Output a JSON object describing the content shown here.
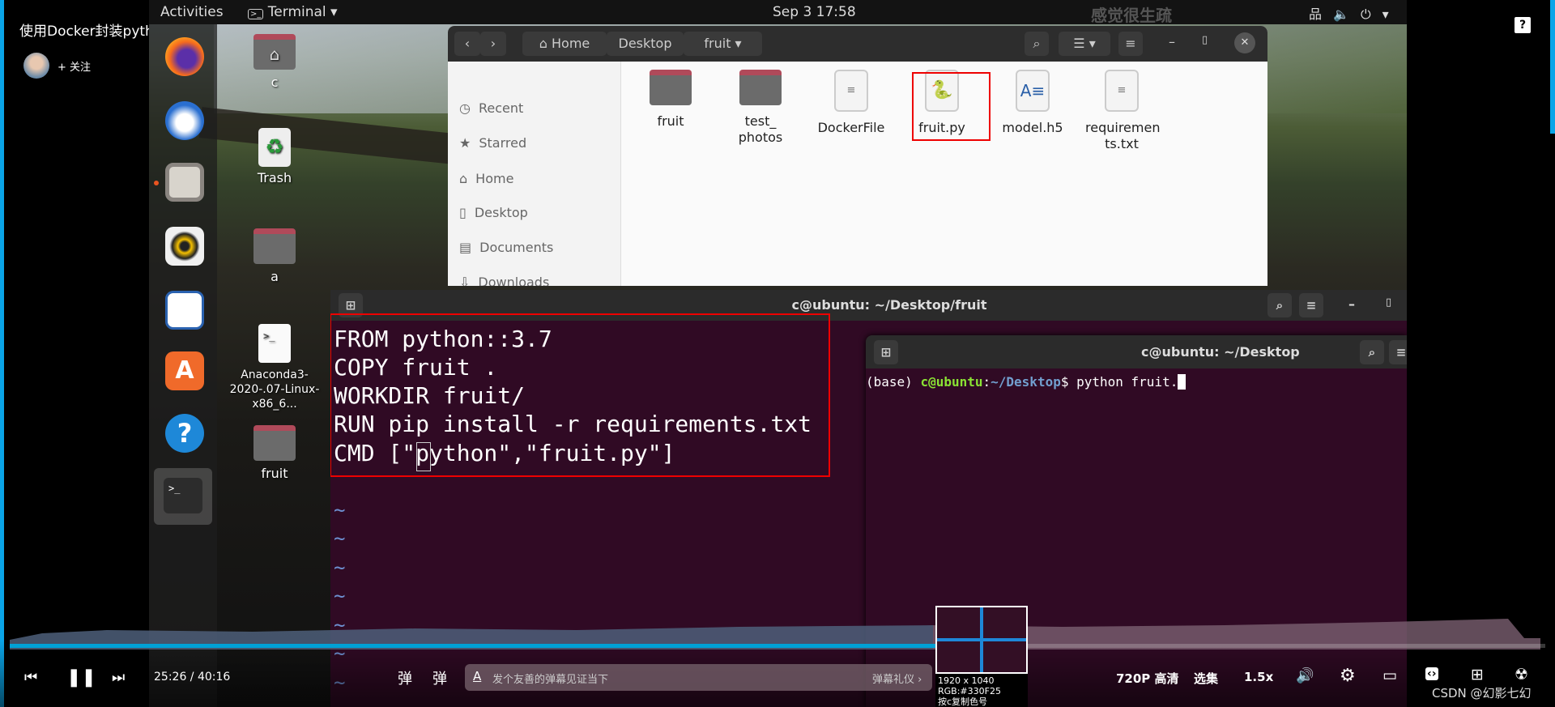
{
  "video": {
    "title": "使用Docker封装python应用",
    "follow": "+ 关注",
    "help_icon": "question-icon"
  },
  "topbar": {
    "activities": "Activities",
    "app": "Terminal ▾",
    "datetime": "Sep 3  17:58",
    "overlay_caption": "感觉很生疏"
  },
  "desktop": {
    "icons": [
      {
        "label": "c"
      },
      {
        "label": "Trash"
      },
      {
        "label": "a"
      },
      {
        "label": "Anaconda3-2020-.07-Linux-x86_6..."
      },
      {
        "label": "fruit"
      }
    ]
  },
  "dock": [
    "firefox-icon",
    "thunderbird-icon",
    "files-icon",
    "rhythmbox-icon",
    "writer-icon",
    "software-icon",
    "help-icon",
    "terminal-icon"
  ],
  "files": {
    "path": [
      "Home",
      "Desktop",
      "fruit"
    ],
    "sidebar": [
      "Recent",
      "Starred",
      "Home",
      "Desktop",
      "Documents",
      "Downloads"
    ],
    "items": [
      {
        "name": "fruit",
        "type": "folder"
      },
      {
        "name": "test_ photos",
        "type": "folder"
      },
      {
        "name": "DockerFile",
        "type": "text"
      },
      {
        "name": "fruit.py",
        "type": "python",
        "highlighted": true
      },
      {
        "name": "model.h5",
        "type": "document"
      },
      {
        "name": "requiremen ts.txt",
        "type": "text"
      }
    ]
  },
  "terminal_main": {
    "title": "c@ubuntu: ~/Desktop/fruit",
    "lines": [
      "FROM python::3.7",
      "COPY fruit .",
      "WORKDIR fruit/",
      "RUN pip install -r requirements.txt",
      "CMD [\"python\",\"fruit.py\"]"
    ],
    "tilde": "~"
  },
  "terminal_small": {
    "title": "c@ubuntu: ~/Desktop",
    "prompt_env": "(base) ",
    "prompt_user": "c@ubuntu",
    "prompt_sep": ":",
    "prompt_path": "~/Desktop",
    "prompt_end": "$ ",
    "command": "python fruit."
  },
  "player": {
    "progress": 0.635,
    "time": "25:26 / 40:16",
    "danmaku_placeholder": "发个友善的弹幕见证当下",
    "danmaku_etiquette": "弹幕礼仪 ›",
    "quality": "720P 高清",
    "episodes": "选集",
    "speed": "1.5x",
    "accent": "#00a1d6"
  },
  "color_picker": {
    "size": "1920 x 1040",
    "rgb": "RGB:#330F25",
    "hint": "按c复制色号"
  },
  "watermark": "CSDN @幻影七幻"
}
